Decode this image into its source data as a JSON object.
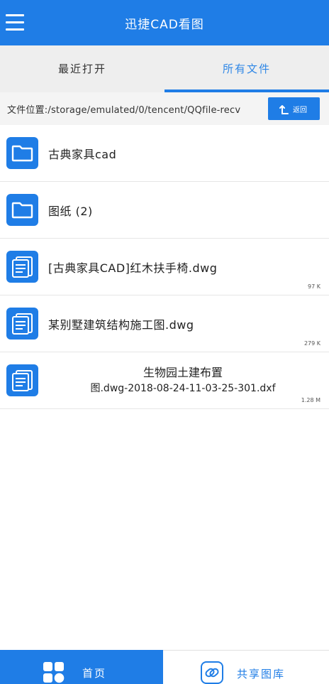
{
  "header": {
    "title": "迅捷CAD看图",
    "menu_icon": "hamburger-menu-icon"
  },
  "tabs": [
    {
      "label": "最近打开",
      "active": false
    },
    {
      "label": "所有文件",
      "active": true
    }
  ],
  "pathbar": {
    "path": "文件位置:/storage/emulated/0/tencent/QQfile-recv",
    "back_label": "返回",
    "back_icon": "return-arrow-icon"
  },
  "files": [
    {
      "name": "古典家具cad",
      "type": "folder",
      "icon": "folder-icon",
      "size": ""
    },
    {
      "name": "图纸 (2)",
      "type": "folder",
      "icon": "folder-icon",
      "size": ""
    },
    {
      "name": "[古典家具CAD]红木扶手椅.dwg",
      "type": "file",
      "icon": "document-icon",
      "size": "97 K"
    },
    {
      "name": "某别墅建筑结构施工图.dwg",
      "type": "file",
      "icon": "document-icon",
      "size": "279 K"
    },
    {
      "name_line1": "生物园土建布置",
      "name_line2": "图.dwg-2018-08-24-11-03-25-301.dxf",
      "type": "file",
      "icon": "document-icon",
      "size": "1.28 M"
    }
  ],
  "bottom_nav": {
    "home_label": "首页",
    "home_icon": "grid-home-icon",
    "share_label": "共享图库",
    "share_icon": "link-chain-icon"
  },
  "colors": {
    "primary": "#1f7de6",
    "tab_bg": "#eeeeee",
    "path_bg": "#f4f4f4"
  }
}
